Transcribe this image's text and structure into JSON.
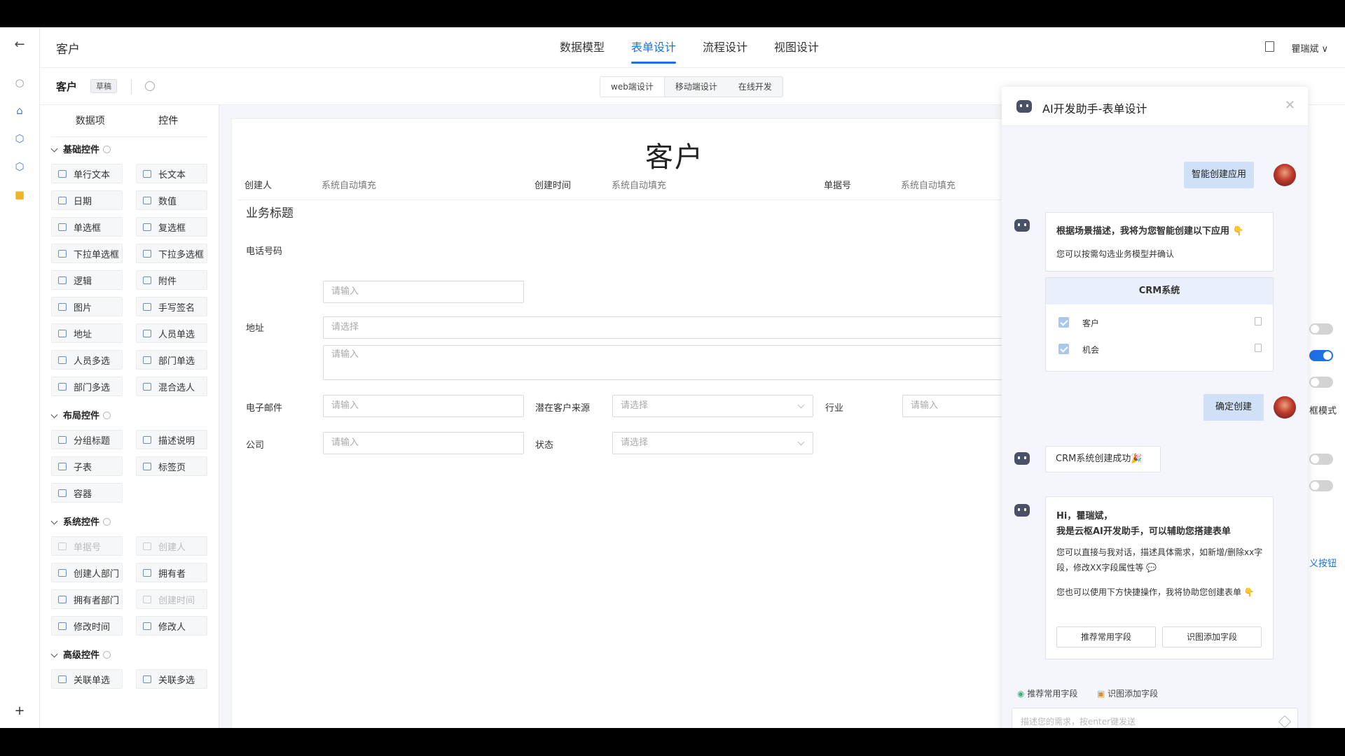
{
  "header": {
    "title": "客户",
    "user": "瞿瑞斌"
  },
  "tabs": [
    "数据模型",
    "表单设计",
    "流程设计",
    "视图设计"
  ],
  "subbar": {
    "name": "客户",
    "status": "草稿",
    "seg": [
      "web端设计",
      "移动端设计",
      "在线开发"
    ]
  },
  "palette": {
    "tabs": [
      "数据项",
      "控件"
    ],
    "groups": [
      {
        "name": "基础控件",
        "items": [
          "单行文本",
          "长文本",
          "日期",
          "数值",
          "单选框",
          "复选框",
          "下拉单选框",
          "下拉多选框",
          "逻辑",
          "附件",
          "图片",
          "手写签名",
          "地址",
          "人员单选",
          "人员多选",
          "部门单选",
          "部门多选",
          "混合选人"
        ]
      },
      {
        "name": "布局控件",
        "items": [
          "分组标题",
          "描述说明",
          "子表",
          "标签页",
          "容器"
        ]
      },
      {
        "name": "系统控件",
        "items": [
          "单据号",
          "创建人",
          "创建人部门",
          "拥有者",
          "拥有者部门",
          "创建时间",
          "修改时间",
          "修改人"
        ]
      },
      {
        "name": "高级控件",
        "items": [
          "关联单选",
          "关联多选"
        ]
      }
    ]
  },
  "form": {
    "title": "客户",
    "creator_label": "创建人",
    "creator_val": "系统自动填充",
    "ctime_label": "创建时间",
    "ctime_val": "系统自动填充",
    "docno_label": "单据号",
    "docno_val": "系统自动填充",
    "section": "业务标题",
    "phone_label": "电话号码",
    "placeholder": "请输入",
    "select_placeholder": "请选择",
    "address_label": "地址",
    "email_label": "电子邮件",
    "source_label": "潜在客户来源",
    "industry_label": "行业",
    "company_label": "公司",
    "status_label": "状态"
  },
  "rightpanel": {
    "mode_label": "框模式",
    "btn_label": "义按钮"
  },
  "ai": {
    "title": "AI开发助手-表单设计",
    "user_msg1": "智能创建应用",
    "bot_msg1_line1": "根据场景描述，我将为您智能创建以下应用 👇",
    "bot_msg1_line2": "您可以按需勾选业务模型并确认",
    "crm_title": "CRM系统",
    "crm_items": [
      "客户",
      "机会"
    ],
    "user_msg2": "确定创建",
    "bot_msg2": "CRM系统创建成功🎉",
    "greet1": "Hi，瞿瑞斌，",
    "greet2": "我是云枢AI开发助手，可以辅助您搭建表单",
    "greet3": "您可以直接与我对话，描述具体需求，如新增/删除xx字段，修改XX字段属性等 💬",
    "greet4": "您也可以使用下方快捷操作，我将协助您创建表单 👇",
    "btn1": "推荐常用字段",
    "btn2": "识图添加字段",
    "quick1": "推荐常用字段",
    "quick2": "识图添加字段",
    "input_placeholder": "描述您的需求，按enter键发送"
  }
}
